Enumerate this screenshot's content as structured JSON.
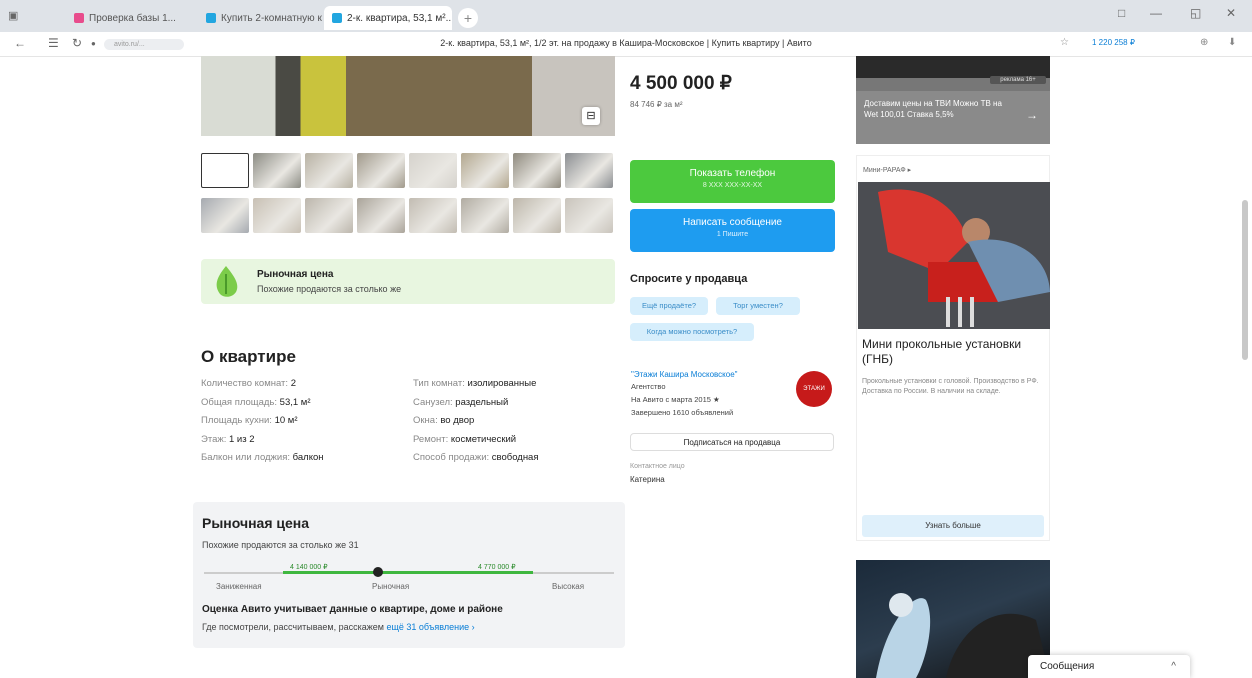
{
  "browser": {
    "tabs": [
      {
        "label": "Проверка базы 1...",
        "color": "#e84c8c"
      },
      {
        "label": "Купить 2-комнатную кв...",
        "color": "#22a6e0"
      },
      {
        "label": "2-к. квартира, 53,1 м²...",
        "color": "#22a6e0"
      }
    ],
    "new_tab": "+",
    "window_controls": [
      "□",
      "—",
      "◱",
      "✕"
    ],
    "nav": [
      "←",
      "☰",
      "↻",
      "●"
    ],
    "url_chip": "avito.ru/...",
    "page_title": "2-к. квартира, 53,1 м², 1/2 эт. на продажу в Кашира-Московское | Купить квартиру | Авито",
    "right_icons": [
      "☆",
      "⊕",
      "⬇"
    ],
    "profile": "1 220 258 ₽"
  },
  "listing": {
    "zoom_icon": "⊟",
    "thumb_colors": [
      "#ffffff",
      "#8c8c84",
      "#b8b2a4",
      "#a19a8c",
      "#d5d2cc",
      "#b3a890",
      "#8f8a7e",
      "#8b8e92",
      "#a6aab0",
      "#c8c0b4",
      "#bcb6ac",
      "#aaa49a",
      "#c2bcb2",
      "#b1aca2",
      "#bdb6aa",
      "#c9c4bc"
    ],
    "market_banner": {
      "title": "Рыночная цена",
      "subtitle": "Похожие продаются за столько же"
    },
    "about": {
      "heading": "О квартире",
      "params_left": [
        {
          "label": "Количество комнат:",
          "value": "2"
        },
        {
          "label": "Общая площадь:",
          "value": "53,1 м²"
        },
        {
          "label": "Площадь кухни:",
          "value": "10 м²"
        },
        {
          "label": "Этаж:",
          "value": "1 из 2"
        },
        {
          "label": "Балкон или лоджия:",
          "value": "балкон"
        }
      ],
      "params_right": [
        {
          "label": "Тип комнат:",
          "value": "изолированные"
        },
        {
          "label": "Санузел:",
          "value": "раздельный"
        },
        {
          "label": "Окна:",
          "value": "во двор"
        },
        {
          "label": "Ремонт:",
          "value": "косметический"
        },
        {
          "label": "Способ продажи:",
          "value": "свободная"
        }
      ]
    },
    "market_price": {
      "heading": "Рыночная цена",
      "subtitle": "Похожие продаются за столько же 31",
      "tick_left": "4 140 000 ₽",
      "tick_right": "4 770 000 ₽",
      "label_low": "Заниженная",
      "label_mid": "Рыночная",
      "label_high": "Высокая",
      "note": "Оценка Авито учитывает данные о квартире, доме и районе",
      "note2_prefix": "Где посмотрели, рассчитываем, расскажем ",
      "note2_link": "ещё 31 объявление ›"
    }
  },
  "sidebar": {
    "price": "4 500 000 ₽",
    "price_per_m": "84 746 ₽ за м²",
    "phone_btn": {
      "label": "Показать телефон",
      "sub": "8 XXX XXX-XX-XX",
      "color": "#4cc93e"
    },
    "msg_btn": {
      "label": "Написать сообщение",
      "sub": "1 Пишите",
      "color": "#1e9cf0"
    },
    "ask_heading": "Спросите у продавца",
    "chips": [
      "Ещё продаёте?",
      "Торг уместен?",
      "Когда можно посмотреть?"
    ],
    "seller_name": "\"Этажи Кашира Московское\"",
    "seller_lines": [
      "Агентство",
      "На Авито с марта 2015 ★",
      "Завершено 1610 объявлений"
    ],
    "seller_logo": "ЭТАЖИ",
    "subscribe": "Подписаться на продавца",
    "contact_label": "Контактное лицо",
    "contact_value": "Катерина"
  },
  "ads": {
    "ad1_badge": "реклама 16+",
    "ad1_text": "Доставим цены на ТВИ Можно ТВ на Wet 100,01 Ставка 5,5%",
    "ad1_arrow": "→",
    "ad2_top": "Мини-РАРАФ ▸",
    "ad2_title": "Мини прокольные установки (ГНБ)",
    "ad2_desc": "Прокольные установки с головой. Производство в РФ. Доставка по России. В наличии на складе.",
    "ad2_btn": "Узнать больше",
    "messages_label": "Сообщения",
    "messages_chevron": "^"
  }
}
